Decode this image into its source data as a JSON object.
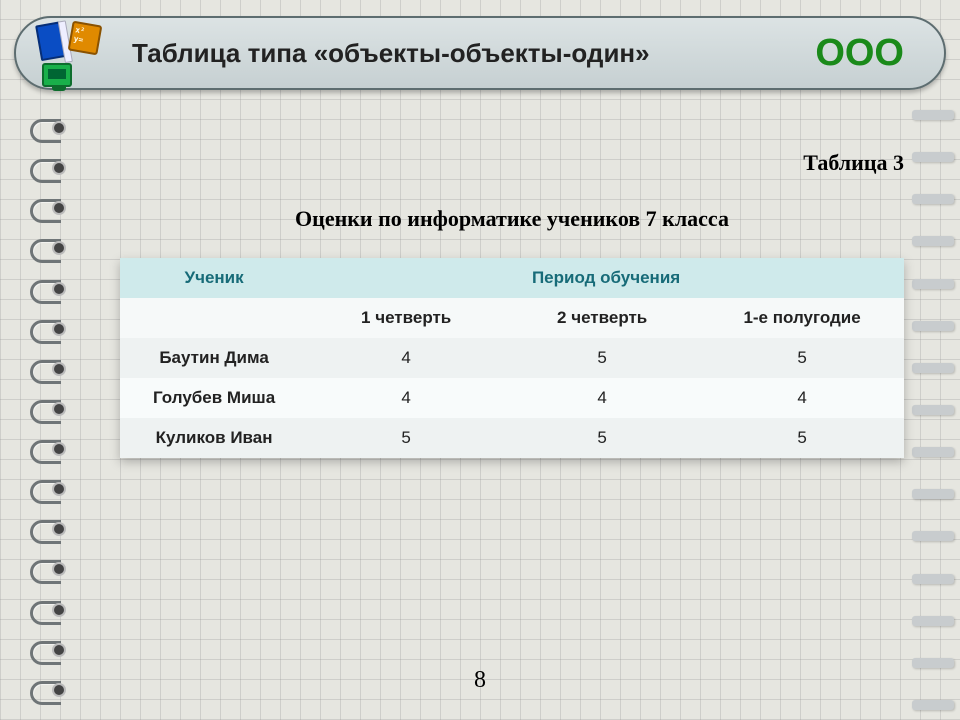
{
  "header": {
    "title": "Таблица типа «объекты-объекты-один»",
    "badge": "ООО"
  },
  "label": "Таблица 3",
  "caption": "Оценки по информатике учеников 7 класса",
  "table": {
    "col_student": "Ученик",
    "col_period": "Период обучения",
    "periods": [
      "1 четверть",
      "2 четверть",
      "1-е полугодие"
    ],
    "rows": [
      {
        "name": "Баутин Дима",
        "vals": [
          "4",
          "5",
          "5"
        ]
      },
      {
        "name": "Голубев Миша",
        "vals": [
          "4",
          "4",
          "4"
        ]
      },
      {
        "name": "Куликов Иван",
        "vals": [
          "5",
          "5",
          "5"
        ]
      }
    ]
  },
  "page_number": "8",
  "chart_data": {
    "type": "table",
    "title": "Оценки по информатике учеников 7 класса",
    "columns": [
      "Ученик",
      "1 четверть",
      "2 четверть",
      "1-е полугодие"
    ],
    "rows": [
      [
        "Баутин Дима",
        4,
        5,
        5
      ],
      [
        "Голубев Миша",
        4,
        4,
        4
      ],
      [
        "Куликов Иван",
        5,
        5,
        5
      ]
    ]
  }
}
